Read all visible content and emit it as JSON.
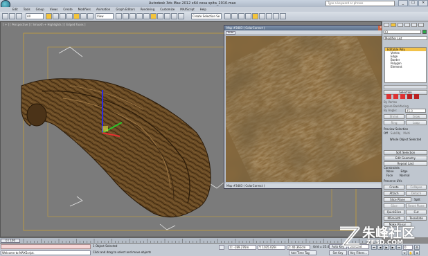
{
  "app": {
    "title": "Autodesk 3ds Max  2012 x64      cesa spita_2010.max",
    "search_placeholder": "Type a keyword or phrase",
    "window_buttons": [
      "_",
      "□",
      "×"
    ]
  },
  "menus": [
    "Edit",
    "Tools",
    "Group",
    "Views",
    "Create",
    "Modifiers",
    "Animation",
    "Graph Editors",
    "Rendering",
    "Customize",
    "MAXScript",
    "Help"
  ],
  "toolbar": {
    "filter": "All",
    "coord": "View",
    "selection_set": "Create Selection Se"
  },
  "viewport": {
    "label": "[ + ] [ Perspective ] [ Smooth + Highlights ] [ Edged Faces ]"
  },
  "map_window": {
    "title": "Map #3483 ( ColorCorrect )",
    "auto_button": "Auto",
    "update_button": "Update",
    "status": "Map #3483 ( ColorCorrect )"
  },
  "command_panel": {
    "object_name": "Cl",
    "modifier_list": "Modifier List",
    "stack": [
      {
        "label": "Editable Poly",
        "selected": true
      },
      {
        "label": "Vertex",
        "selected": false
      },
      {
        "label": "Edge",
        "selected": false
      },
      {
        "label": "Border",
        "selected": false
      },
      {
        "label": "Polygon",
        "selected": false
      },
      {
        "label": "Element",
        "selected": false
      }
    ],
    "selection_rollout": "Selection",
    "by_vertex": "By Vertex",
    "ignore_backfacing": "Ignore Backfacing",
    "by_angle": "By Angle:",
    "by_angle_value": "45.0",
    "shrink": "Shrink",
    "grow": "Grow",
    "ring": "Ring",
    "loop": "Loop",
    "preview_selection": "Preview Selection",
    "preview_options": [
      "Off",
      "SubObj",
      "Multi"
    ],
    "whole_object_selected": "Whole Object Selected",
    "soft_selection": "Soft Selection",
    "edit_geometry": "Edit Geometry",
    "repeat_last": "Repeat Last",
    "constraints": "Constraints",
    "constraint_options": [
      "None",
      "Edge",
      "Face",
      "Normal"
    ],
    "preserve_uvs": "Preserve UVs",
    "create": "Create",
    "collapse": "Collapse",
    "attach": "Attach",
    "detach": "Detach",
    "slice_plane": "Slice Plane",
    "split": "Split",
    "slice": "Slice",
    "reset_plane": "Reset Plane",
    "quickslice": "QuickSlice",
    "cut": "Cut",
    "msmooth": "MSmooth",
    "tessellate": "Tessellate",
    "make_planar": "Make Planar"
  },
  "time_slider": {
    "frame": "0 / 100"
  },
  "status": {
    "maxscript": "Welcome to MAXScript.",
    "selected": "1 Object Selected",
    "prompt": "Click and drag to select and move objects",
    "x": "X: -189.276m",
    "y": "Y: 1035.029i",
    "z": "Z: 40.363cm",
    "grid": "Grid = 25.4cm",
    "auto_key": "Auto Key",
    "selected_mode": "Selected",
    "set_key": "Set Key",
    "key_filters": "Key Filters...",
    "add_time_tag": "Add Time Tag",
    "frame_field": "0"
  },
  "watermark": {
    "text": "朱峰社区",
    "sub": "ZF3D.COM"
  }
}
